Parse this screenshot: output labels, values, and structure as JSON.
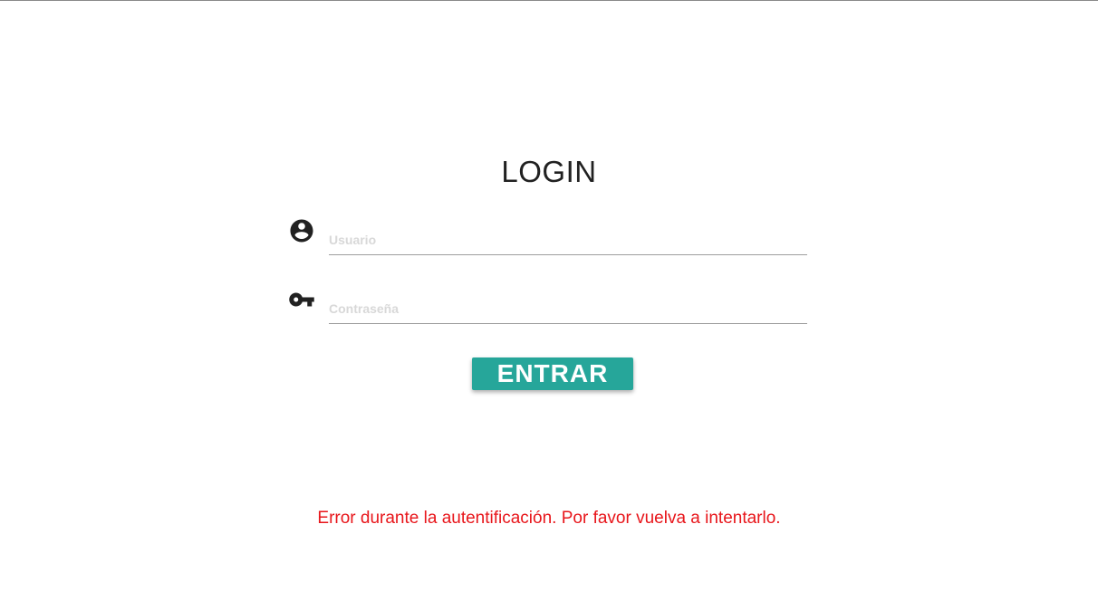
{
  "login": {
    "title": "LOGIN",
    "username": {
      "icon": "account-circle-icon",
      "placeholder": "Usuario",
      "value": ""
    },
    "password": {
      "icon": "key-icon",
      "placeholder": "Contraseña",
      "value": ""
    },
    "submit_label": "ENTRAR",
    "error_message": "Error durante la autentificación. Por favor vuelva a intentarlo."
  },
  "colors": {
    "accent": "#26a69a",
    "error": "#e8161b",
    "text": "#212121"
  }
}
